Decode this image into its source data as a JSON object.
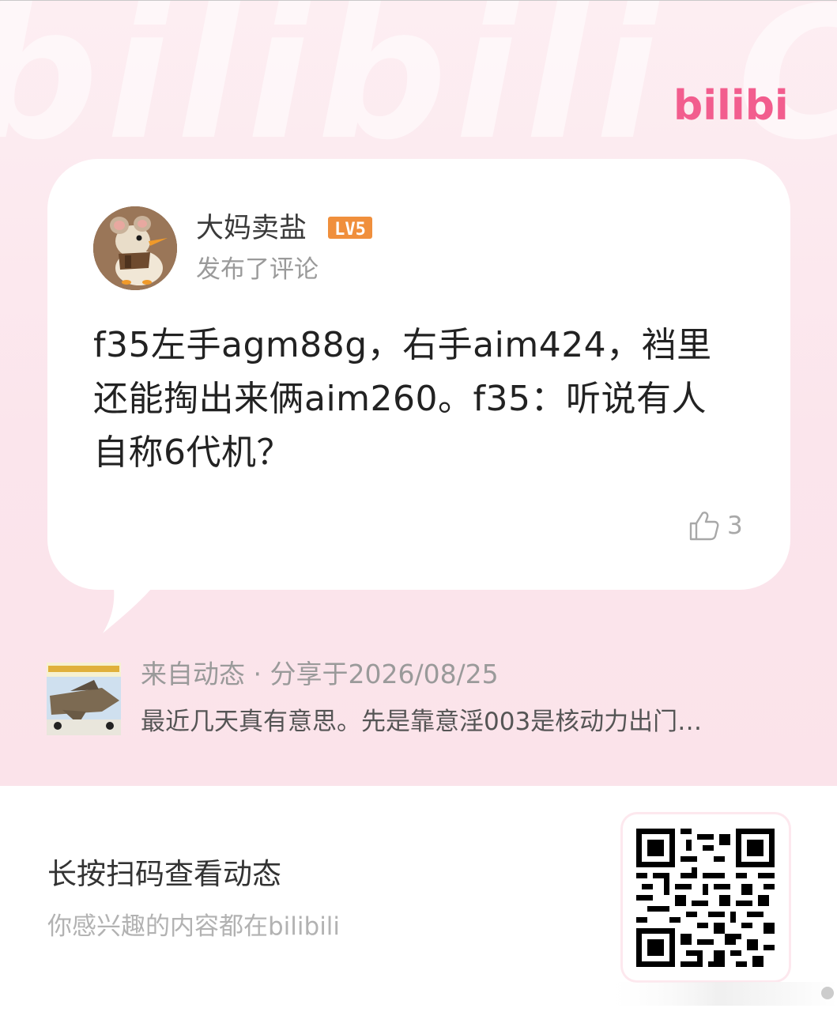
{
  "brand": {
    "logo_text": "bilibili",
    "watermark_text": "bilibili COMMENT",
    "accent_color": "#f25d8e"
  },
  "comment": {
    "user_name": "大妈卖盐",
    "level_badge": "LV5",
    "level_color": "#f08f3c",
    "action_text": "发布了评论",
    "body": "f35左手agm88g，右手aim424，裆里还能掏出来俩aim260。f35：听说有人自称6代机？",
    "like_count": "3",
    "avatar_icon": "mouse-duck-avatar"
  },
  "source": {
    "meta": "来自动态 · 分享于2026/08/25",
    "description": "最近几天真有意思。先是靠意淫003是核动力出门…",
    "thumbnail_icon": "fighter-jet-thumbnail"
  },
  "footer": {
    "qr_title": "长按扫码查看动态",
    "qr_hint": "你感兴趣的内容都在bilibili",
    "qr_icon": "qr-code-icon"
  }
}
